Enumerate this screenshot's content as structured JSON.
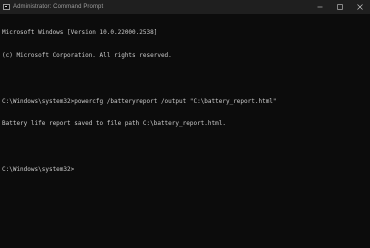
{
  "window": {
    "title": "Administrator: Command Prompt",
    "icon": "command-prompt-icon",
    "controls": [
      "minimize-icon",
      "maximize-icon",
      "close-icon"
    ]
  },
  "console": {
    "lines": [
      "Microsoft Windows [Version 10.0.22000.2538]",
      "(c) Microsoft Corporation. All rights reserved.",
      "",
      "C:\\Windows\\system32>powercfg /batteryreport /output \"C:\\battery_report.html\"",
      "Battery life report saved to file path C:\\battery_report.html.",
      "",
      "C:\\Windows\\system32>"
    ]
  },
  "colors": {
    "background": "#0c0c0c",
    "titlebar": "#1f1f1f",
    "text": "#cccccc"
  }
}
